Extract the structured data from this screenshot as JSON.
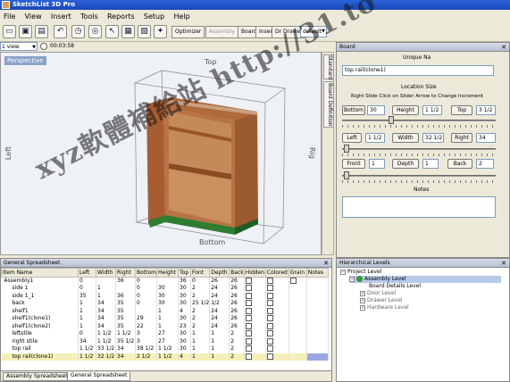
{
  "window": {
    "title": "SketchList 3D Pro"
  },
  "menu": [
    "File",
    "View",
    "Insert",
    "Tools",
    "Reports",
    "Setup",
    "Help"
  ],
  "toolbar": {
    "optimizer_label": "Optimizer",
    "assembly_label": "Assembly",
    "board_label": "Board",
    "insert_label": "Insert",
    "drawer_label": "Dr Drawer",
    "style_value": "default"
  },
  "viewstrip": {
    "view_value": "1 view",
    "timer": "00:03:58"
  },
  "viewport": {
    "mode": "Perspective",
    "top_label": "Top",
    "left_label": "Left",
    "right_label": "Rig",
    "bottom_label": "Bottom"
  },
  "side_tabs": [
    "Standard",
    "Board Definition"
  ],
  "board_panel": {
    "title": "Board",
    "unique_name_label": "Unique Na",
    "name_value": "top rail(clone1)",
    "location_size_label": "Location Size",
    "instructions": "Right Slide Click on Slider Arrow to Change Increment",
    "bottom_btn": "Bottom",
    "bottom_value": "30",
    "height_btn": "Height",
    "height_value": "1 1/2",
    "top_btn": "Top",
    "top_value": "3 1/2",
    "left_btn": "Left",
    "left_value": "1 1/2",
    "width_btn": "Width",
    "width_value": "32 1/2",
    "right_btn": "Right",
    "right_value": "34",
    "front_btn": "Front",
    "front_value": "1",
    "depth_btn": "Depth",
    "depth_value": "1",
    "back_btn": "Back",
    "back_value": "2",
    "notes_label": "Notes"
  },
  "spreadsheet": {
    "title": "General Spreadsheet",
    "columns": [
      "Item Name",
      "Left",
      "Width",
      "Right",
      "Bottom",
      "Height",
      "Top",
      "Font",
      "Depth",
      "Back",
      "Hidden",
      "Colored",
      "Grain",
      "Notes"
    ],
    "rows": [
      [
        "Assembly1",
        "0",
        "",
        "36",
        "0",
        "",
        "36",
        "0",
        "26",
        "26"
      ],
      [
        "side 1",
        "0",
        "1",
        "",
        "0",
        "30",
        "30",
        "2",
        "24",
        "26"
      ],
      [
        "side 1_1",
        "35",
        "1",
        "36",
        "0",
        "30",
        "30",
        "2",
        "24",
        "26"
      ],
      [
        "back",
        "1",
        "34",
        "35",
        "0",
        "30",
        "30",
        "25 1/2",
        "1/2",
        "26"
      ],
      [
        "shelf1",
        "1",
        "34",
        "35",
        "",
        "1",
        "4",
        "2",
        "24",
        "26"
      ],
      [
        "shelf1(clone1)",
        "1",
        "34",
        "35",
        "29",
        "1",
        "30",
        "2",
        "24",
        "26"
      ],
      [
        "shelf1(clone2)",
        "1",
        "34",
        "35",
        "22",
        "1",
        "23",
        "2",
        "24",
        "26"
      ],
      [
        "leftstile",
        "0",
        "1 1/2",
        "1 1/2",
        "3",
        "27",
        "30",
        "1",
        "1",
        "2"
      ],
      [
        "right stile",
        "34",
        "1 1/2",
        "35 1/2",
        "3",
        "27",
        "30",
        "1",
        "1",
        "2"
      ],
      [
        "top rail",
        "1 1/2",
        "33 1/2",
        "34",
        "38 1/2",
        "1 1/2",
        "30",
        "1",
        "1",
        "2"
      ],
      [
        "top rail(clone1)",
        "1 1/2",
        "32 1/2",
        "34",
        "2 1/2",
        "1 1/2",
        "4",
        "1",
        "1",
        "2"
      ]
    ],
    "tabs": [
      "Assembly Spreadsheet",
      "General Spreadsheet"
    ]
  },
  "hierarchy": {
    "title": "Hierarchical Levels",
    "items": [
      "Project Level",
      "Assembly Level",
      "Board Details Level",
      "Door Level",
      "Drawer Level",
      "Hardware Level"
    ]
  },
  "watermark": "xyz軟體補給站 http://31.to"
}
